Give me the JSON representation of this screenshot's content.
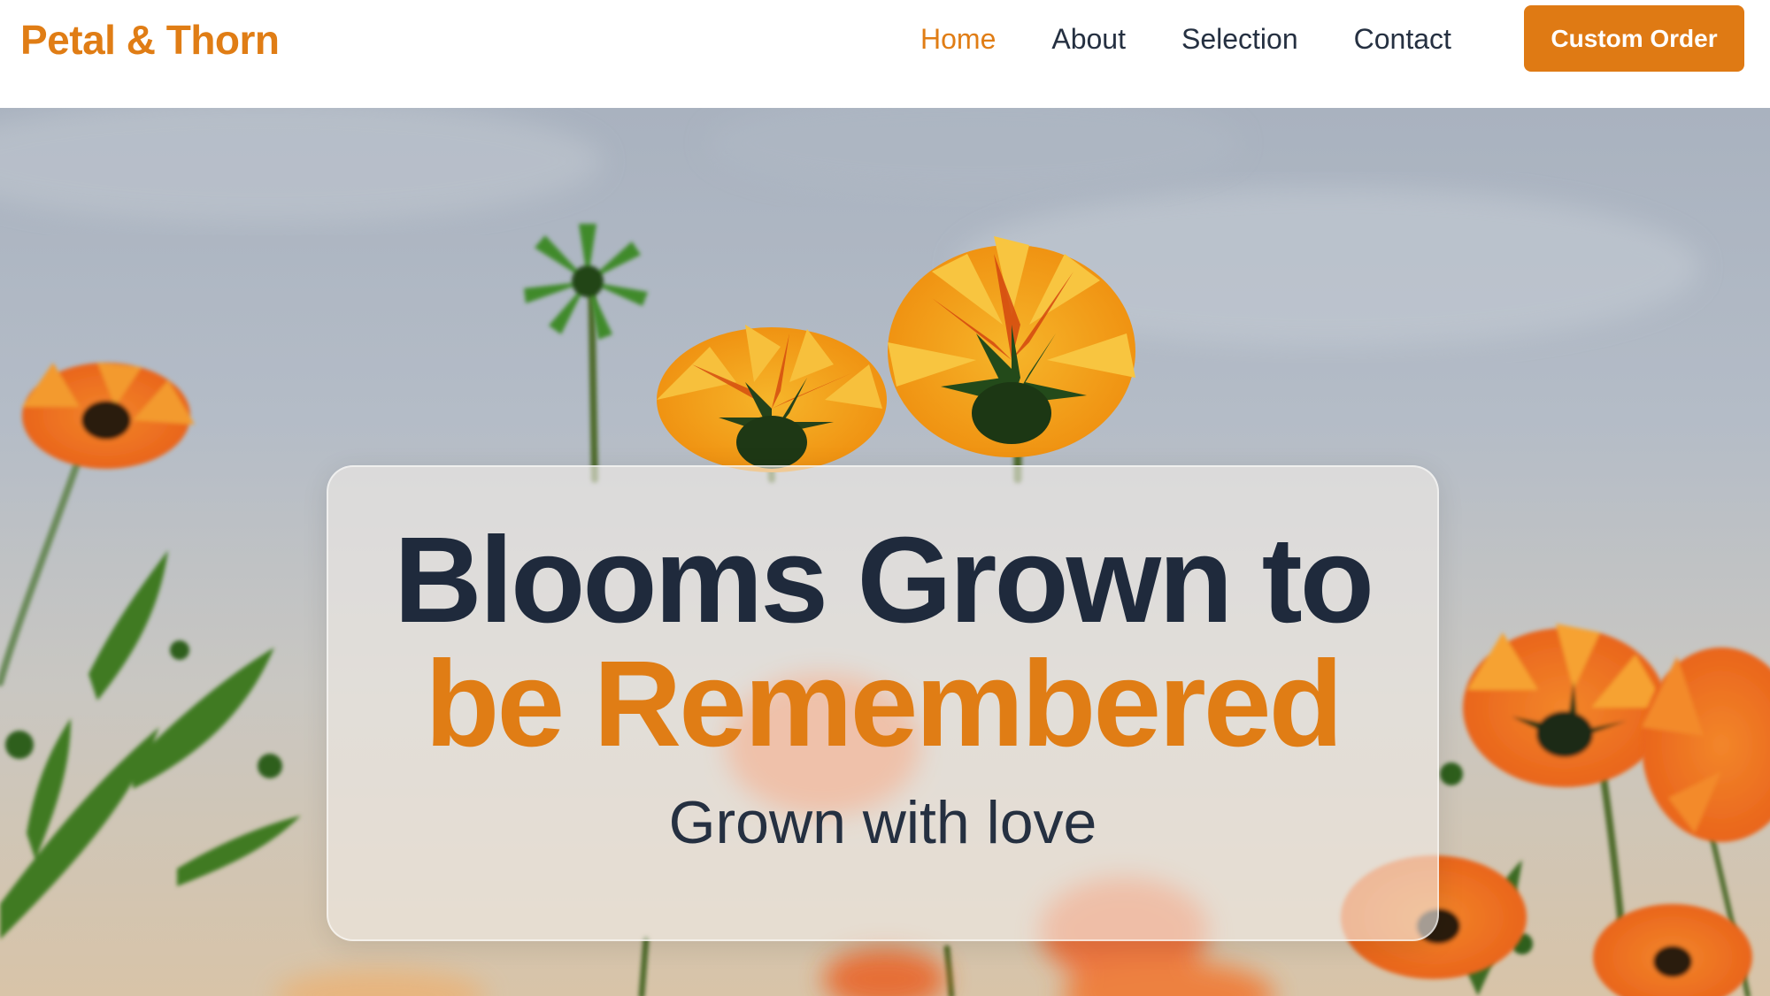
{
  "brand": {
    "name": "Petal & Thorn"
  },
  "nav": {
    "links": [
      {
        "label": "Home",
        "active": true
      },
      {
        "label": "About",
        "active": false
      },
      {
        "label": "Selection",
        "active": false
      },
      {
        "label": "Contact",
        "active": false
      }
    ],
    "cta_label": "Custom Order"
  },
  "hero": {
    "title_line1": "Blooms Grown to",
    "title_line2": "be Remembered",
    "subtitle": "Grown with love"
  },
  "colors": {
    "accent": "#e07d15",
    "heading": "#1f2a3c",
    "text": "#253041",
    "background": "#ffffff"
  },
  "icons": [
    "flower-photo"
  ]
}
